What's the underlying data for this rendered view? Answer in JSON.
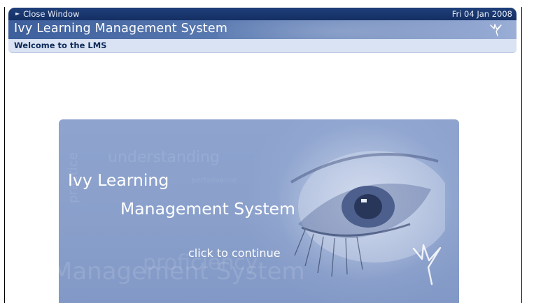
{
  "topbar": {
    "close_label": "Close Window",
    "date": "Fri 04 Jan 2008"
  },
  "header": {
    "title": "Ivy Learning Management System",
    "welcome": "Welcome to the LMS"
  },
  "splash": {
    "line1": "Ivy Learning",
    "line2": "Management System",
    "continue_label": "click to continue",
    "watermarks": [
      "understanding",
      "performance",
      "proficiency",
      "Management System",
      "practice"
    ]
  },
  "colors": {
    "topbar_bg": "#1a3a72",
    "title_band": "#5070a8",
    "welcome_bg": "#d9e3f3",
    "splash_bg": "#8ea4cf"
  }
}
